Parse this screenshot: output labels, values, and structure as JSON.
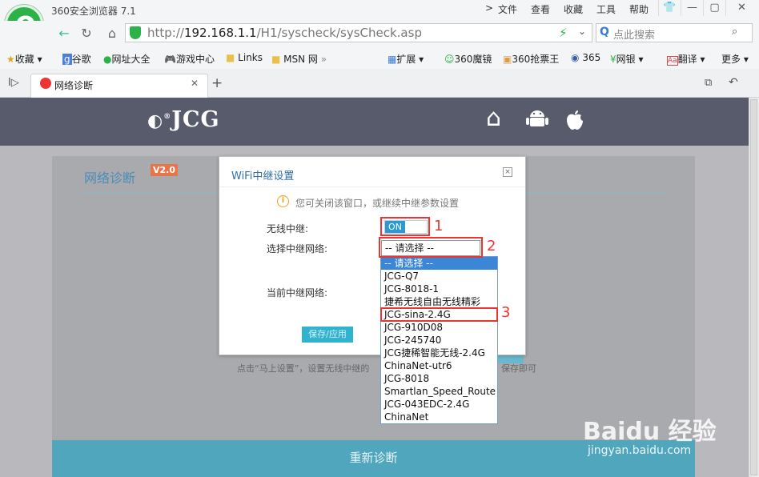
{
  "browser": {
    "app_title": "360安全浏览器 7.1",
    "menu": [
      "文件",
      "查看",
      "收藏",
      "工具",
      "帮助"
    ],
    "url_prefix": "http://",
    "url_host": "192.168.1.1",
    "url_path": "/H1/syscheck/sysCheck.asp",
    "search_placeholder": "点此搜索",
    "bookmarks": [
      "收藏",
      "谷歌",
      "网址大全",
      "游戏中心",
      "Links",
      "MSN 网",
      "扩展",
      "360魔镜",
      "360抢票王",
      "365",
      "网银",
      "翻译",
      "更多"
    ],
    "tab_title": "网络诊断"
  },
  "page": {
    "brand": "JCG",
    "card_title": "网络诊断",
    "version_badge": "V2.0",
    "hint_left": "点击“马上设置”，设置无线中继的",
    "hint_right": "保存即可",
    "rediagnose": "重新诊断"
  },
  "dialog": {
    "title": "WiFi中继设置",
    "close": "×",
    "info": "您可关闭该窗口，或继续中继参数设置",
    "wireless_relay_label": "无线中继:",
    "toggle_state": "ON",
    "select_network_label": "选择中继网络:",
    "select_value": "-- 请选择 --",
    "current_network_label": "当前中继网络:",
    "save_button": "保存/应用",
    "options": [
      "-- 请选择 --",
      "JCG-Q7",
      "JCG-8018-1",
      "捷希无线自由无线精彩",
      "JCG-sina-2.4G",
      "JCG-910D08",
      "JCG-245740",
      "JCG捷稀智能无线-2.4G",
      "ChinaNet-utr6",
      "JCG-8018",
      "Smartlan_Speed_Route",
      "JCG-043EDC-2.4G",
      "ChinaNet"
    ],
    "selected_index": 0
  },
  "annotations": {
    "n1": "1",
    "n2": "2",
    "n3": "3"
  },
  "watermark": {
    "brand": "Baidu 经验",
    "url": "jingyan.baidu.com"
  }
}
